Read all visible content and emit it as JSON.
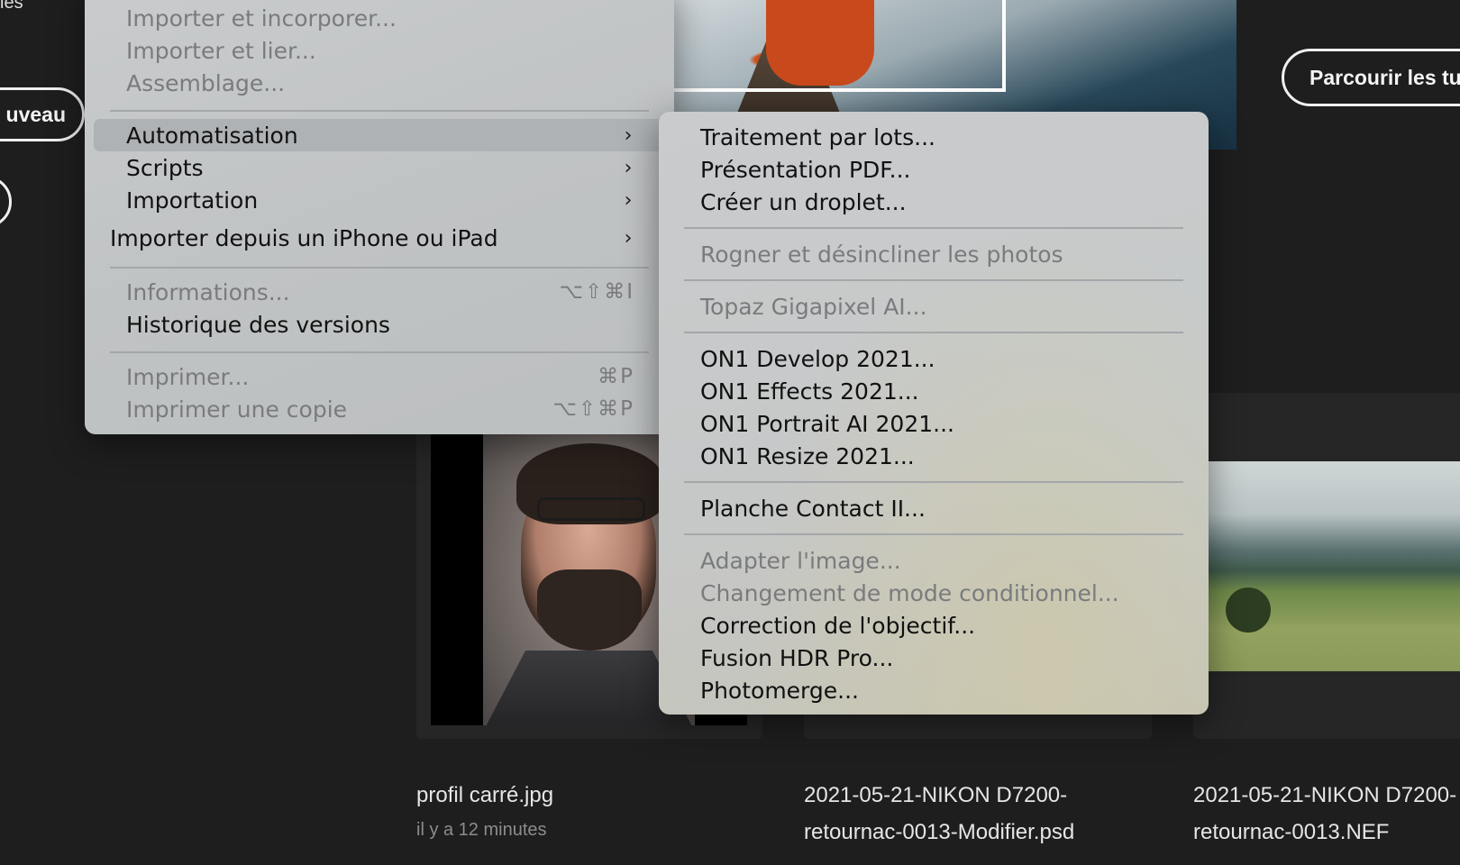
{
  "background": {
    "left_label": "ies",
    "new_button_label": "uveau",
    "browse_button_label": "Parcourir les tu",
    "recent_files": [
      {
        "name_line1": "profil carré.jpg",
        "name_line2": "",
        "time": "il y a 12 minutes"
      },
      {
        "name_line1": "2021-05-21-NIKON D7200-",
        "name_line2": "retournac-0013-Modifier.psd",
        "time": ""
      },
      {
        "name_line1": "2021-05-21-NIKON D7200-",
        "name_line2": "retournac-0013.NEF",
        "time": ""
      }
    ]
  },
  "file_menu": {
    "items": [
      {
        "label": "Importer et incorporer...",
        "disabled": true
      },
      {
        "label": "Importer et lier...",
        "disabled": true
      },
      {
        "label": "Assemblage...",
        "disabled": true
      },
      {
        "label": "Automatisation",
        "submenu": true,
        "highlighted": true
      },
      {
        "label": "Scripts",
        "submenu": true
      },
      {
        "label": "Importation",
        "submenu": true
      },
      {
        "label": "Importer depuis un iPhone ou iPad",
        "submenu": true
      },
      {
        "label": "Informations...",
        "disabled": true,
        "shortcut": "⌥⇧⌘I"
      },
      {
        "label": "Historique des versions"
      },
      {
        "label": "Imprimer...",
        "disabled": true,
        "shortcut": "⌘P"
      },
      {
        "label": "Imprimer une copie",
        "disabled": true,
        "shortcut": "⌥⇧⌘P"
      }
    ],
    "submenu_chevron": "›"
  },
  "automation_submenu": {
    "items": [
      {
        "label": "Traitement par lots..."
      },
      {
        "label": "Présentation PDF..."
      },
      {
        "label": "Créer un droplet..."
      },
      {
        "label": "Rogner et désincliner les photos",
        "disabled": true
      },
      {
        "label": "Topaz Gigapixel AI...",
        "disabled": true
      },
      {
        "label": "ON1 Develop 2021..."
      },
      {
        "label": "ON1 Effects 2021..."
      },
      {
        "label": "ON1 Portrait AI 2021..."
      },
      {
        "label": "ON1 Resize 2021..."
      },
      {
        "label": "Planche Contact II..."
      },
      {
        "label": "Adapter l'image...",
        "disabled": true
      },
      {
        "label": "Changement de mode conditionnel...",
        "disabled": true
      },
      {
        "label": "Correction de l'objectif..."
      },
      {
        "label": "Fusion HDR Pro..."
      },
      {
        "label": "Photomerge..."
      }
    ]
  },
  "colors": {
    "menu_bg": "#c4c6c8",
    "highlight": "#aeb2b5",
    "text": "#111111",
    "disabled_text": "#7a7b7c",
    "app_bg": "#1e1e1e"
  },
  "icons": {
    "submenu_arrow": "chevron-right-icon"
  }
}
